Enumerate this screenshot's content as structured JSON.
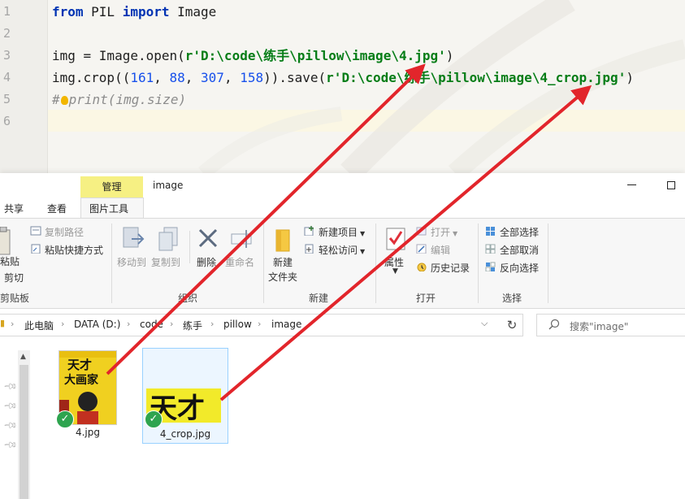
{
  "editor": {
    "lines": [
      {
        "num": "1",
        "tokens": [
          {
            "t": "from",
            "c": "kw"
          },
          {
            "t": " PIL ",
            "c": ""
          },
          {
            "t": "import",
            "c": "kw"
          },
          {
            "t": " Image",
            "c": ""
          }
        ]
      },
      {
        "num": "2",
        "tokens": []
      },
      {
        "num": "3",
        "tokens": [
          {
            "t": "img = Image.open(",
            "c": ""
          },
          {
            "t": "r'D:\\code\\练手\\pillow\\image\\4.jpg'",
            "c": "str"
          },
          {
            "t": ")",
            "c": ""
          }
        ]
      },
      {
        "num": "4",
        "tokens": [
          {
            "t": "img.crop((",
            "c": ""
          },
          {
            "t": "161",
            "c": "num"
          },
          {
            "t": ", ",
            "c": ""
          },
          {
            "t": "88",
            "c": "num"
          },
          {
            "t": ", ",
            "c": ""
          },
          {
            "t": "307",
            "c": "num"
          },
          {
            "t": ", ",
            "c": ""
          },
          {
            "t": "158",
            "c": "num"
          },
          {
            "t": ")).save(",
            "c": ""
          },
          {
            "t": "r'D:\\code\\练手\\pillow\\image\\4_crop.jpg'",
            "c": "str"
          },
          {
            "t": ")",
            "c": ""
          }
        ]
      },
      {
        "num": "5",
        "tokens": [
          {
            "t": "#",
            "c": "cmt"
          },
          {
            "t": "",
            "c": "bulb"
          },
          {
            "t": "print(img.size)",
            "c": "cmt"
          }
        ]
      },
      {
        "num": "6",
        "tokens": []
      }
    ]
  },
  "window": {
    "context_tab": "管理",
    "title": "image"
  },
  "ribbon_tabs": {
    "share": "共享",
    "view": "查看",
    "picture_tools": "图片工具"
  },
  "ribbon": {
    "paste": "粘贴",
    "cut": "剪切",
    "copy_path": "复制路径",
    "paste_shortcut": "粘贴快捷方式",
    "clipboard_group": "剪贴板",
    "move_to": "移动到",
    "copy_to": "复制到",
    "delete": "删除",
    "rename": "重命名",
    "organize_group": "组织",
    "new_folder_line1": "新建",
    "new_folder_line2": "文件夹",
    "new_item": "新建项目",
    "easy_access": "轻松访问",
    "new_group": "新建",
    "properties": "属性",
    "open": "打开",
    "edit": "编辑",
    "history": "历史记录",
    "open_group": "打开",
    "select_all": "全部选择",
    "select_none": "全部取消",
    "invert_selection": "反向选择",
    "select_group": "选择"
  },
  "address": {
    "crumbs": [
      "此电脑",
      "DATA (D:)",
      "code",
      "练手",
      "pillow",
      "image"
    ]
  },
  "search": {
    "placeholder": "搜索\"image\""
  },
  "files": [
    {
      "name": "4.jpg",
      "thumb_text": "天才大画家"
    },
    {
      "name": "4_crop.jpg",
      "thumb_text": "天才"
    }
  ],
  "colors": {
    "arrow": "#e2252b",
    "context_tab": "#f6f083",
    "keyword": "#0033b3",
    "string": "#067d17"
  }
}
